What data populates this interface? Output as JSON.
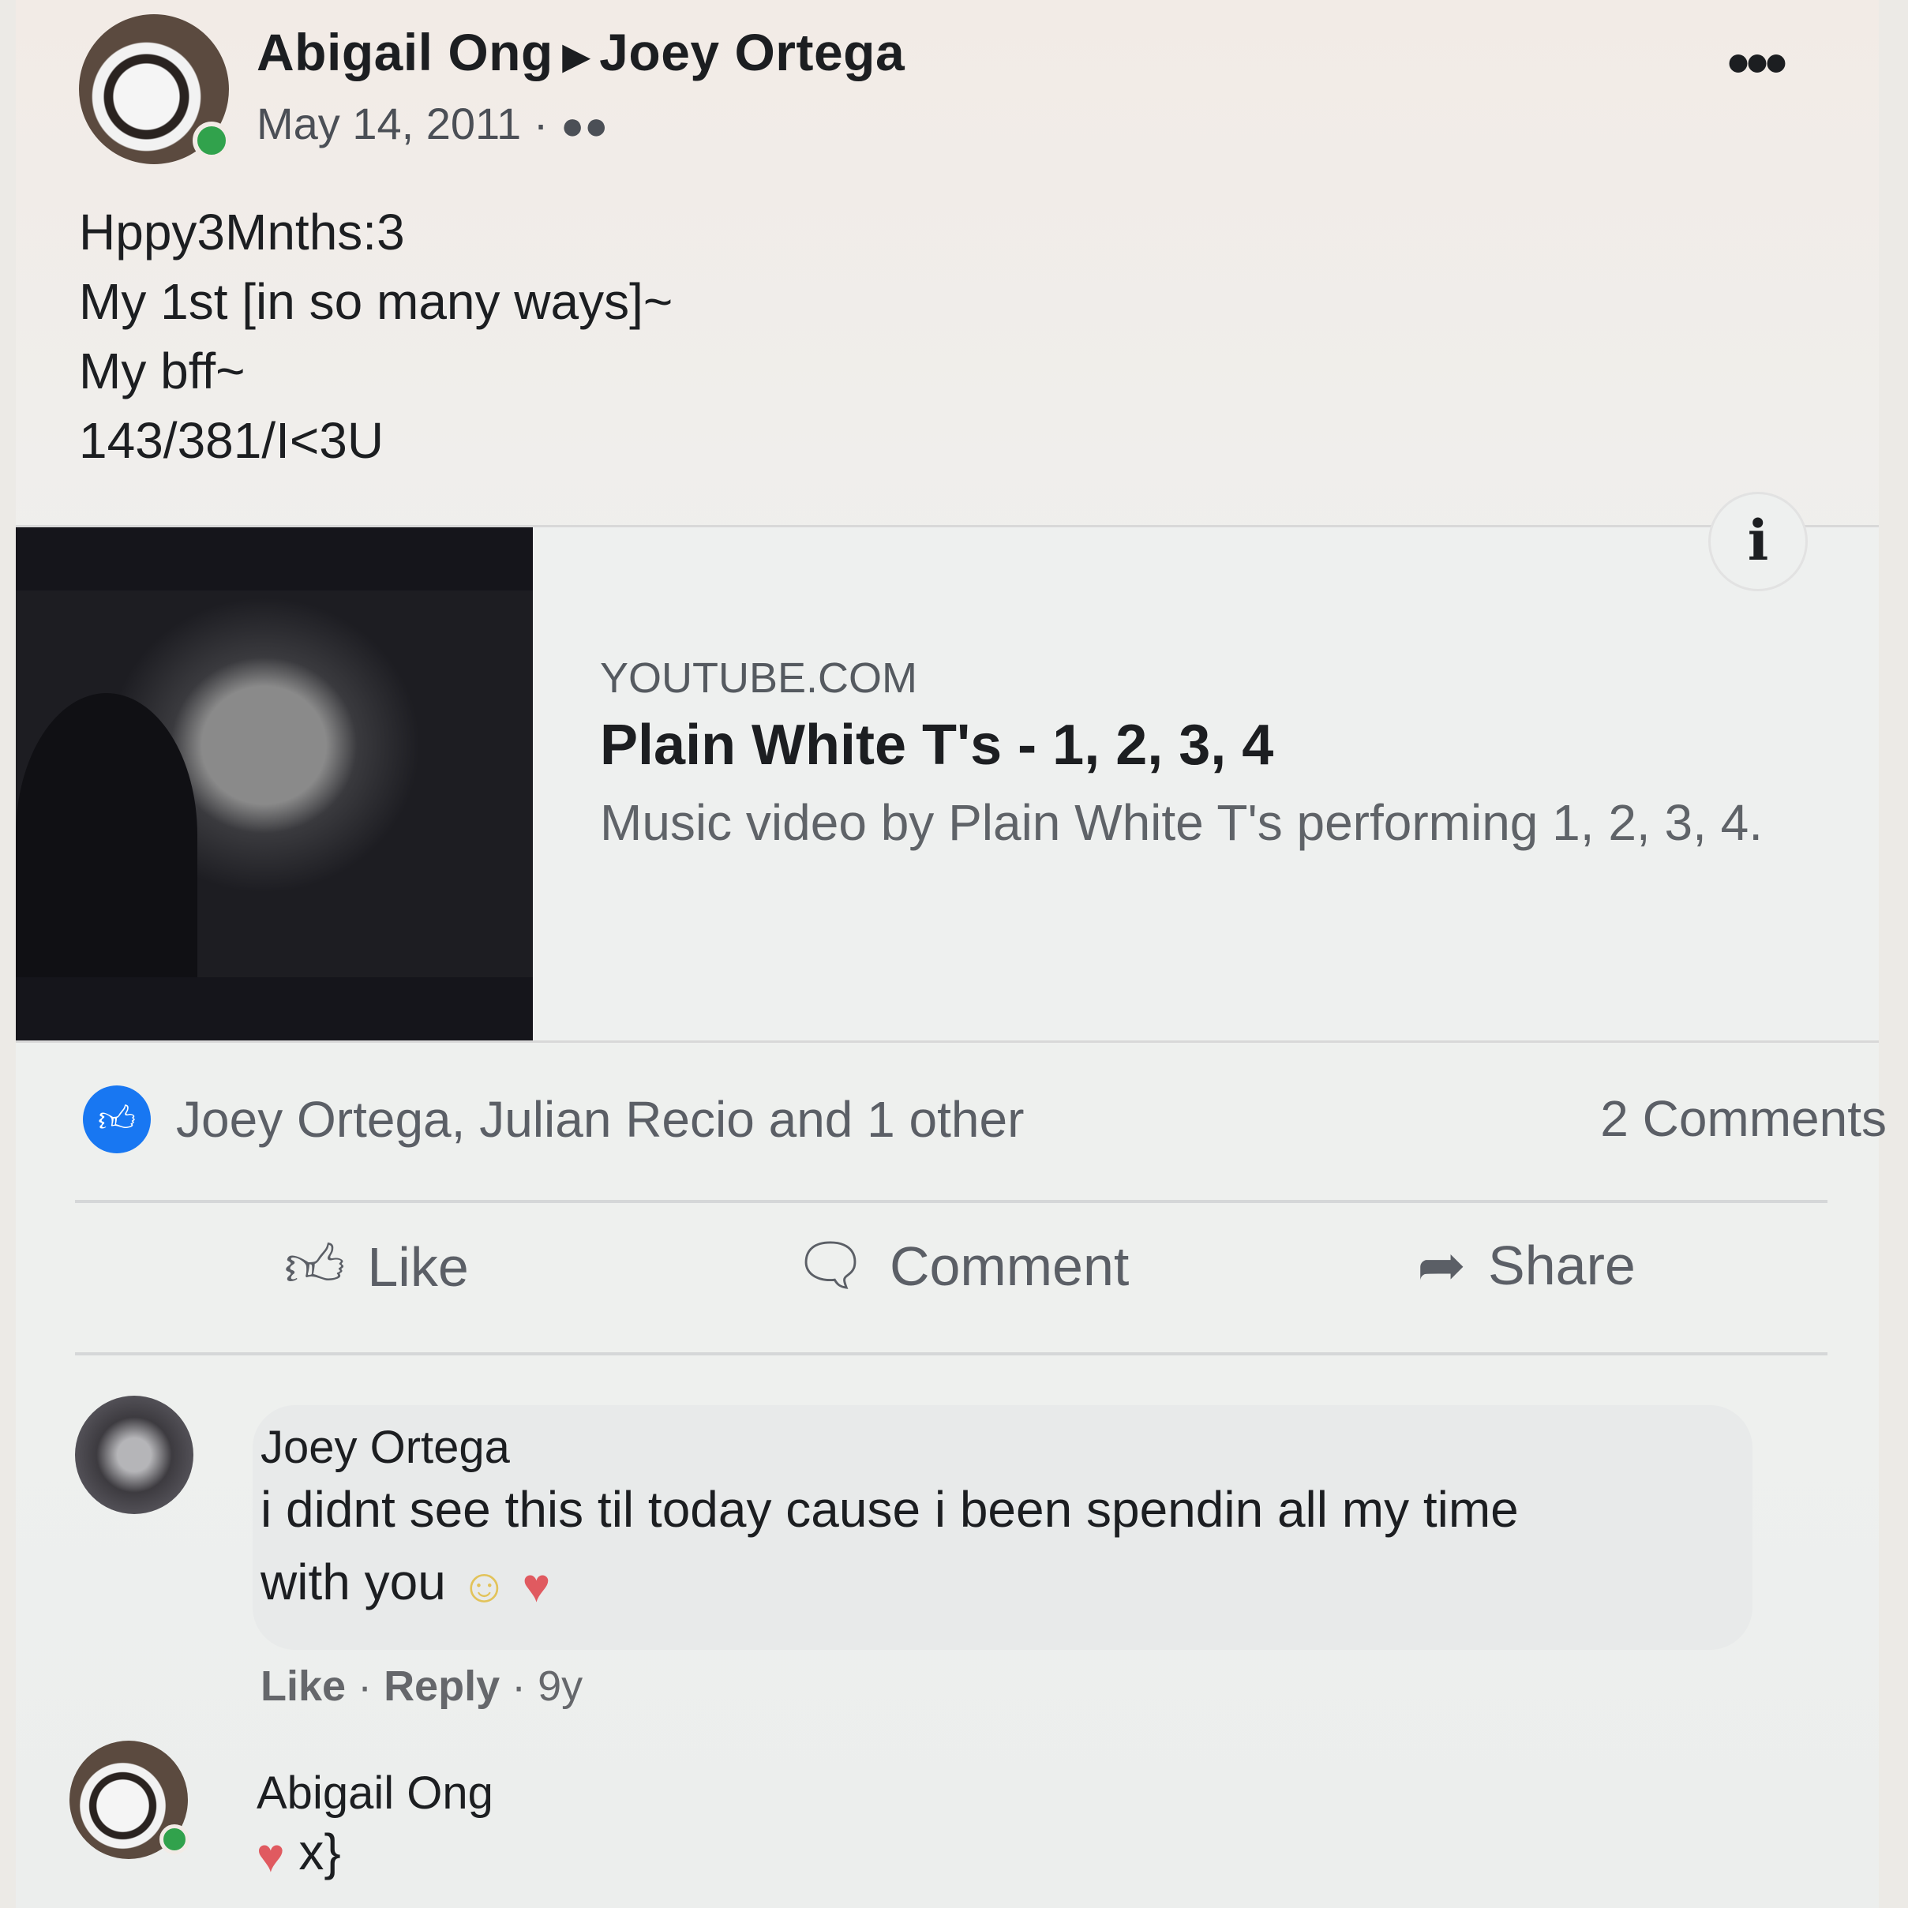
{
  "post": {
    "author": "Abigail Ong",
    "recipient": "Joey Ortega",
    "date": "May 14, 2011 ·",
    "audience_icon": "friends-icon",
    "more_label": "•••",
    "text_lines": [
      "Hppy3Mnths:3",
      "My 1st [in so many ways]~",
      "My bff~",
      "143/381/I<3U"
    ]
  },
  "link": {
    "domain": "YOUTUBE.COM",
    "title": "Plain White T's - 1, 2, 3, 4",
    "description": "Music video by Plain White T's performing 1, 2, 3, 4.",
    "info_label": "i"
  },
  "reactions": {
    "summary": "Joey Ortega, Julian Recio and 1 other",
    "comments_count": "2 Comments"
  },
  "actions": {
    "like": "Like",
    "comment": "Comment",
    "share": "Share"
  },
  "comments": [
    {
      "name": "Joey Ortega",
      "text_line1": "i didnt see this til today cause i been spendin all my time",
      "text_line2": "with you",
      "like": "Like",
      "reply": "Reply",
      "age": "9y"
    },
    {
      "name": "Abigail Ong",
      "text": "x}"
    }
  ],
  "colors": {
    "like_blue": "#1877f2",
    "online_green": "#31a24c",
    "heart": "#e05a60"
  }
}
